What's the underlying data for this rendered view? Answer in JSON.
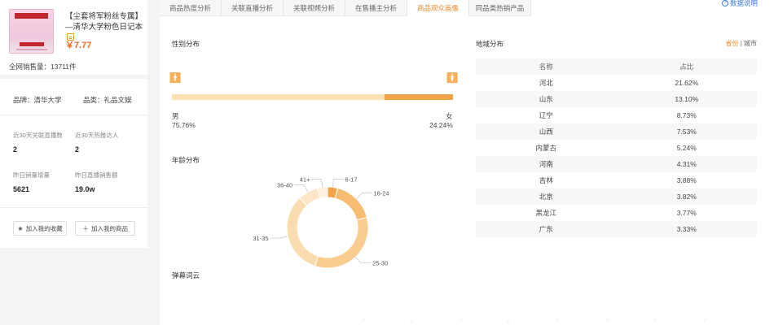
{
  "product": {
    "title": "【尘套将军粉丝专属】—清华大学粉色日记本",
    "price": "￥7.77",
    "sales_label": "全网销售量：",
    "sales_value": "13711件",
    "brand_label": "品牌：",
    "brand_value": "清华大学",
    "category_label": "品类：",
    "category_value": "礼品文娱",
    "stats": [
      {
        "label": "近30天关联直播数",
        "value": "2"
      },
      {
        "label": "近30天热推达人",
        "value": "2"
      },
      {
        "label": "昨日销量增量",
        "value": "5621"
      },
      {
        "label": "昨日直播销售额",
        "value": "19.0w"
      }
    ],
    "buttons": {
      "favorite": "加入我的收藏",
      "my_products": "加入我的商品"
    }
  },
  "tabs": [
    {
      "label": "商品热度分析",
      "active": false
    },
    {
      "label": "关联直播分析",
      "active": false
    },
    {
      "label": "关联视频分析",
      "active": false
    },
    {
      "label": "在售播主分析",
      "active": false
    },
    {
      "label": "商品观众画像",
      "active": true
    },
    {
      "label": "同品类热销产品",
      "active": false
    }
  ],
  "help_label": "数据说明",
  "gender": {
    "title": "性别分布",
    "male_label": "男",
    "male_pct": "75.76%",
    "male_value": 75.76,
    "female_label": "女",
    "female_pct": "24.24%",
    "female_value": 24.24
  },
  "age": {
    "title": "年龄分布",
    "segments": [
      {
        "label": "6-17",
        "value": 4,
        "color": "#f2a34a"
      },
      {
        "label": "18-24",
        "value": 17,
        "color": "#f6bd72"
      },
      {
        "label": "25-30",
        "value": 34,
        "color": "#f9cd90"
      },
      {
        "label": "31-35",
        "value": 33,
        "color": "#fbdcb0"
      },
      {
        "label": "36-40",
        "value": 8,
        "color": "#fde6c8"
      },
      {
        "label": "41+",
        "value": 4,
        "color": "#fef0de"
      }
    ]
  },
  "wordcloud_title": "弹幕词云",
  "region": {
    "title": "地域分布",
    "toggle_province": "省份",
    "toggle_sep": "|",
    "toggle_city": "城市",
    "columns": [
      "名称",
      "占比"
    ],
    "rows": [
      [
        "河北",
        "21.62%"
      ],
      [
        "山东",
        "13.10%"
      ],
      [
        "辽宁",
        "8.73%"
      ],
      [
        "山西",
        "7.53%"
      ],
      [
        "内蒙古",
        "5.24%"
      ],
      [
        "河南",
        "4.31%"
      ],
      [
        "吉林",
        "3.88%"
      ],
      [
        "北京",
        "3.82%"
      ],
      [
        "黑龙江",
        "3.77%"
      ],
      [
        "广东",
        "3.33%"
      ]
    ]
  },
  "colors": {
    "accent": "#ef8a2a",
    "link": "#3b7dd8"
  }
}
